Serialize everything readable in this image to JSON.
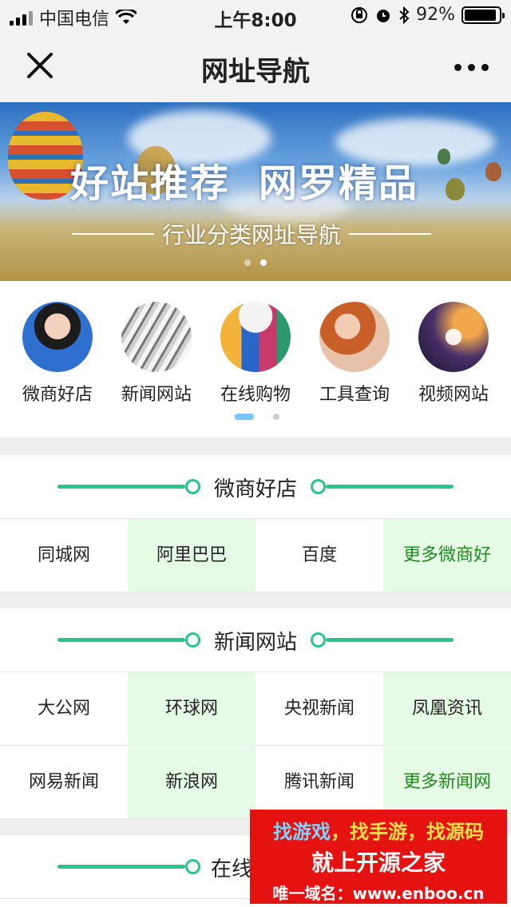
{
  "status_bar": {
    "carrier": "中国电信",
    "time": "上午8:00",
    "battery_percent": "92%",
    "battery_level": 0.92
  },
  "nav": {
    "title": "网址导航",
    "close_icon": "close-icon",
    "more_icon": "more-icon"
  },
  "banner": {
    "headline_1": "好站推荐",
    "headline_2": "网罗精品",
    "subtitle": "行业分类网址导航",
    "slide_count": 2,
    "active_slide": 2
  },
  "categories": {
    "items": [
      {
        "label": "微商好店",
        "icon": "woman-headset-photo"
      },
      {
        "label": "新闻网站",
        "icon": "newspaper-photo"
      },
      {
        "label": "在线购物",
        "icon": "shopping-bags-photo"
      },
      {
        "label": "工具查询",
        "icon": "woman-phone-photo"
      },
      {
        "label": "视频网站",
        "icon": "play-icon-photo"
      }
    ],
    "page_count": 2,
    "active_page": 1
  },
  "sections": [
    {
      "title": "微商好店",
      "links": [
        {
          "label": "同城网"
        },
        {
          "label": "阿里巴巴"
        },
        {
          "label": "百度"
        },
        {
          "label": "更多微商好"
        }
      ]
    },
    {
      "title": "新闻网站",
      "links": [
        {
          "label": "大公网"
        },
        {
          "label": "环球网"
        },
        {
          "label": "央视新闻"
        },
        {
          "label": "凤凰资讯"
        },
        {
          "label": "网易新闻"
        },
        {
          "label": "新浪网"
        },
        {
          "label": "腾讯新闻"
        },
        {
          "label": "更多新闻网"
        }
      ]
    },
    {
      "title": "在线"
    }
  ],
  "promo": {
    "line1_a": "找游戏",
    "line1_b": "，找手游，找源码",
    "line2": "就上开源之家",
    "line3": "唯一域名：www.enboo.cn"
  },
  "colors": {
    "accent_green": "#2bc58a",
    "alt_cell_bg": "#e6fbe6",
    "more_link": "#1e8b1e",
    "promo_bg": "#e51212"
  }
}
